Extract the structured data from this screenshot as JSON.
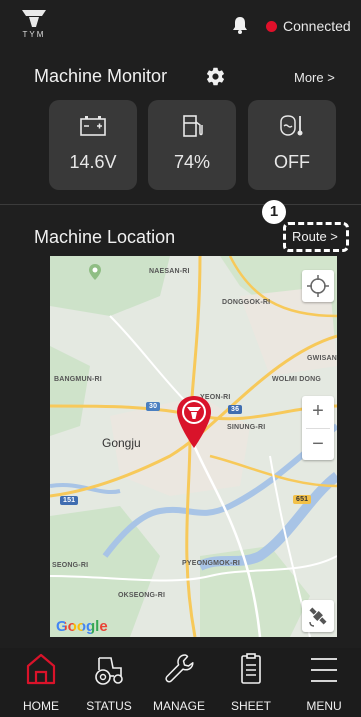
{
  "header": {
    "logo_text": "TYM",
    "connection_status": "Connected",
    "status_color": "#e0102a"
  },
  "machine_monitor": {
    "title": "Machine Monitor",
    "more_label": "More >",
    "cards": [
      {
        "icon": "battery-icon",
        "value": "14.6V"
      },
      {
        "icon": "fuel-icon",
        "value": "74%"
      },
      {
        "icon": "engine-temperature-icon",
        "value": "OFF"
      }
    ]
  },
  "machine_location": {
    "title": "Machine Location",
    "route_label": "Route >",
    "annotation_number": "1"
  },
  "map": {
    "labels": {
      "naesan": "NAESAN-RI",
      "dongdok": "DONGGOK-RI",
      "gwisan": "GWISAN",
      "wolmi": "WOLMI DONG",
      "bangmun": "BANGMUN-RI",
      "yeon": "YEON-RI",
      "sinung": "SINUNG-RI",
      "seong": "SEONG-RI",
      "pyeongmok": "PYEONGMOK-RI",
      "okseong": "OKSEONG-RI",
      "city": "Gongju",
      "route30": "30",
      "route36": "36",
      "route151": "151",
      "route651": "651"
    },
    "google_logo": "Google",
    "zoom_in": "+",
    "zoom_out": "−"
  },
  "tabs": [
    {
      "label": "HOME",
      "active": true
    },
    {
      "label": "STATUS",
      "active": false
    },
    {
      "label": "MANAGE",
      "active": false
    },
    {
      "label": "SHEET",
      "active": false
    },
    {
      "label": "MENU",
      "active": false
    }
  ],
  "colors": {
    "accent": "#d9132a",
    "background": "#1f1f1f",
    "card": "#393939"
  }
}
